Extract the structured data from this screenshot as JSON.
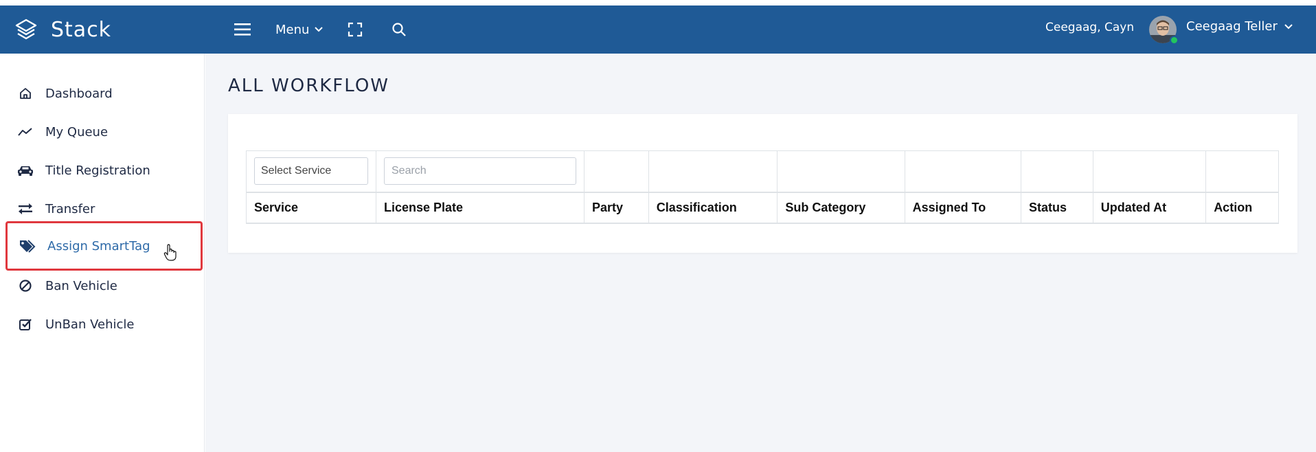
{
  "app": {
    "brand": "Stack"
  },
  "header": {
    "menu_label": "Menu",
    "user_name": "Ceegaag, Cayn",
    "profile_name": "Ceegaag Teller"
  },
  "sidebar": {
    "items": [
      {
        "label": "Dashboard",
        "icon": "home-icon"
      },
      {
        "label": "My Queue",
        "icon": "trend-line-icon"
      },
      {
        "label": "Title Registration",
        "icon": "car-icon"
      },
      {
        "label": "Transfer",
        "icon": "exchange-arrows-icon"
      },
      {
        "label": "Assign SmartTag",
        "icon": "tags-icon",
        "active": true
      },
      {
        "label": "Ban Vehicle",
        "icon": "ban-icon"
      },
      {
        "label": "UnBan Vehicle",
        "icon": "check-square-icon"
      }
    ]
  },
  "page": {
    "title": "ALL WORKFLOW"
  },
  "filters": {
    "service_select": "Select Service",
    "search_placeholder": "Search"
  },
  "table": {
    "columns": [
      "Service",
      "License Plate",
      "Party",
      "Classification",
      "Sub Category",
      "Assigned To",
      "Status",
      "Updated At",
      "Action"
    ],
    "rows": []
  },
  "colors": {
    "header_bg": "#1f5a96",
    "active_item": "#2e6aa8",
    "highlight_border": "#e0383e",
    "online": "#22c55e"
  }
}
